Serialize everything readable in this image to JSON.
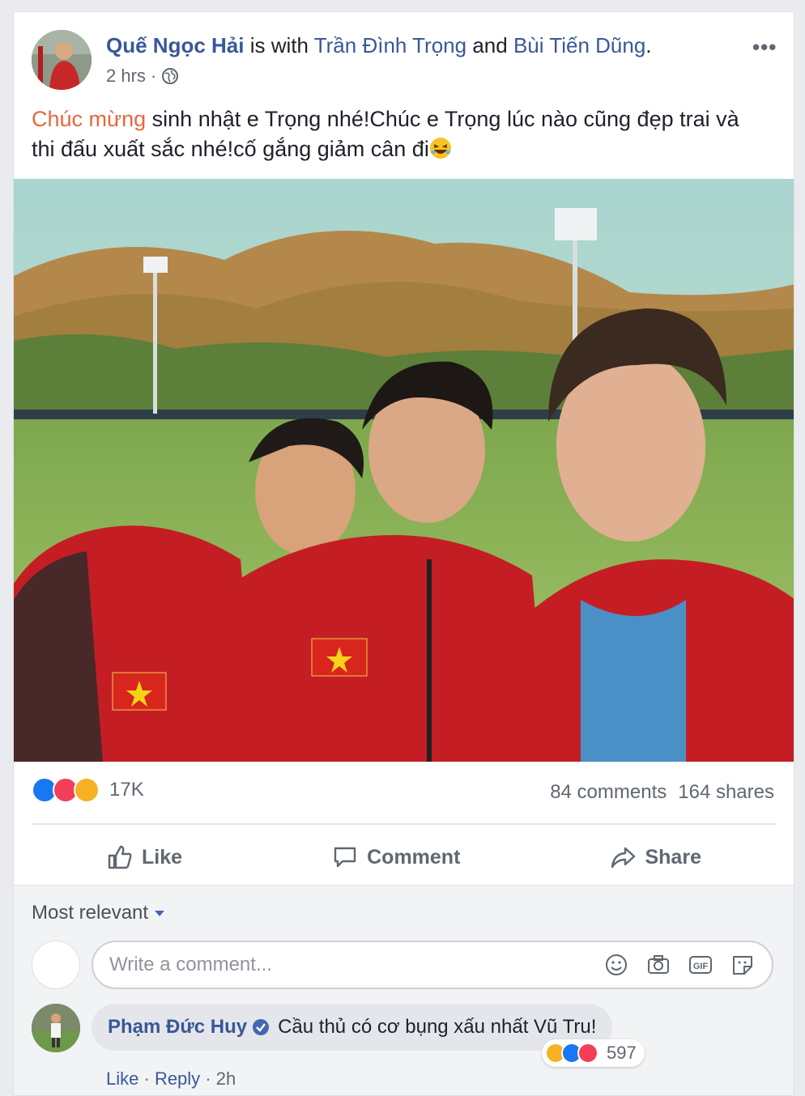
{
  "post": {
    "author": "Quế Ngọc Hải",
    "with_text": "is with",
    "tagged1": "Trần Đình Trọng",
    "and_text": "and",
    "tagged2": "Bùi Tiến Dũng",
    "period": ".",
    "time": "2 hrs",
    "separator": "·",
    "more": "•••",
    "text_highlight": "Chúc mừng",
    "text_body": "sinh nhật e Trọng nhé!Chúc e Trọng lúc nào cũng đẹp trai và thi đấu xuất sắc nhé!cố gắng giảm cân đi",
    "reaction_count": "17K",
    "comments_count": "84 comments",
    "shares_count": "164 shares",
    "colors": {
      "link": "#385898",
      "highlight": "#e9663f",
      "like": "#1877f2",
      "love": "#f33e58",
      "haha": "#f7b125"
    }
  },
  "actions": {
    "like": "Like",
    "comment": "Comment",
    "share": "Share"
  },
  "comments_section": {
    "sort_label": "Most relevant",
    "input_placeholder": "Write a comment...",
    "input_icons": [
      "smiley-icon",
      "camera-icon",
      "gif-icon",
      "sticker-icon"
    ]
  },
  "comment": {
    "author": "Phạm Đức Huy",
    "text": "Cầu thủ có cơ bụng xấu nhất Vũ Tru!",
    "reaction_count": "597",
    "like": "Like",
    "reply": "Reply",
    "dot": "·",
    "time": "2h"
  }
}
